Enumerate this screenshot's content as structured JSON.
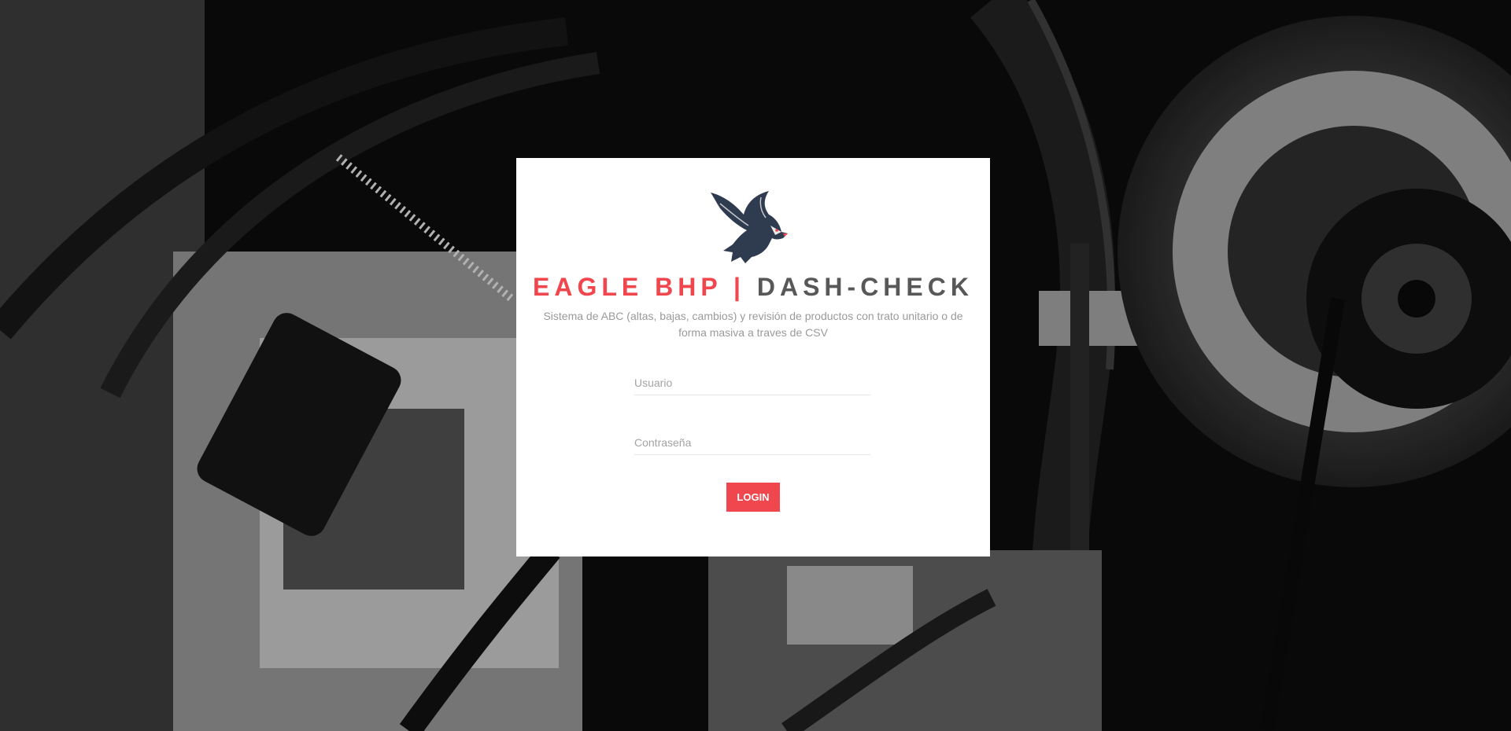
{
  "page": {
    "background_image": "engine-bay-monochrome-photo",
    "accent_color": "#f0464d",
    "text_gray": "#585858"
  },
  "card": {
    "logo_icon": "eagle-logo-icon",
    "title": {
      "brand": "EAGLE BHP",
      "separator": "|",
      "product": "DASH-CHECK"
    },
    "subtitle": "Sistema de ABC (altas, bajas, cambios) y revisión de productos con trato unitario o de forma masiva a traves de CSV",
    "username": {
      "placeholder": "Usuario",
      "value": ""
    },
    "password": {
      "placeholder": "Contraseña",
      "value": ""
    },
    "login_label": "LOGIN"
  }
}
